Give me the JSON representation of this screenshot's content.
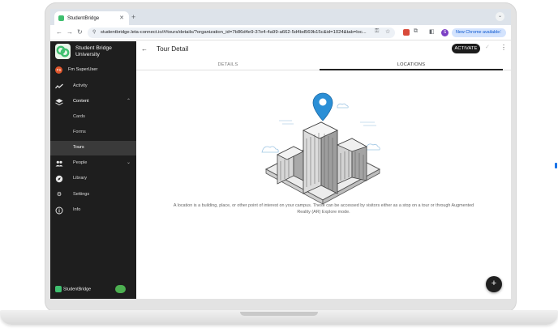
{
  "browser": {
    "tab_title": "StudentBridge",
    "tab_close": "✕",
    "new_tab": "+",
    "url": "studentbridge.leta-connect.io/#/tours/details/?organization_id=7b86d4e9-37e4-4a99-a662-5d4bd569b15c&id=1024&tab=loc...",
    "new_chrome_label": "New Chrome available",
    "profile_initial": "S"
  },
  "sidebar": {
    "brand_line1": "Student Bridge",
    "brand_line2": "University",
    "user_initials": "FS",
    "user_name": "Fm SuperUser",
    "items": [
      {
        "label": "Activity",
        "icon": "activity-icon"
      },
      {
        "label": "Content",
        "icon": "layers-icon"
      },
      {
        "label": "Cards",
        "icon": ""
      },
      {
        "label": "Forms",
        "icon": ""
      },
      {
        "label": "Tours",
        "icon": ""
      },
      {
        "label": "People",
        "icon": "people-icon"
      },
      {
        "label": "Library",
        "icon": "compass-icon"
      },
      {
        "label": "Settings",
        "icon": "gear-icon"
      },
      {
        "label": "Info",
        "icon": "info-icon"
      }
    ],
    "footer_logo": "StudentBridge"
  },
  "main": {
    "title": "Tour Detail",
    "activate_label": "ACTIVATE",
    "tabs": [
      {
        "label": "DETAILS"
      },
      {
        "label": "LOCATIONS"
      }
    ],
    "selected_tab": "LOCATIONS",
    "description": "A location is a building, place, or other point of interest on your campus. These can be accessed by visitors either as a stop on a tour or through Augmented Reality (AR) Explore mode.",
    "fab_label": "+"
  },
  "colors": {
    "sidebar_bg": "#1e1e1e",
    "active_item_bg": "#3a3a3a",
    "pin_blue": "#2b8fd6",
    "brand_green": "#3fbf6f",
    "activate_bg": "#1c1c1c"
  }
}
